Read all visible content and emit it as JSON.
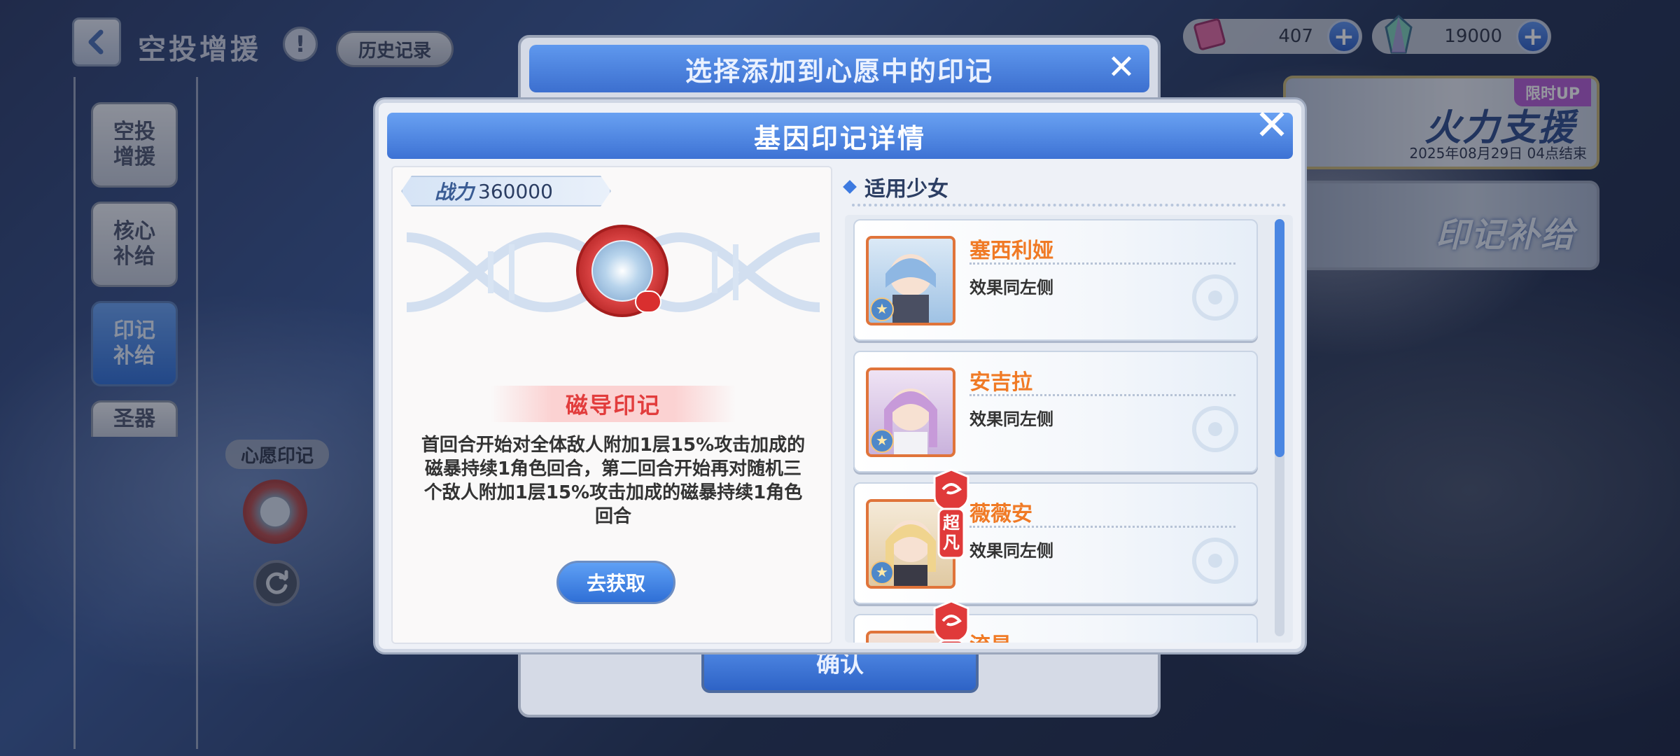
{
  "header": {
    "title": "空投增援",
    "history_label": "历史记录"
  },
  "sidebar": {
    "items": [
      {
        "label": "空投增援",
        "active": false
      },
      {
        "label": "核心补给",
        "active": false
      },
      {
        "label": "印记补给",
        "active": true
      },
      {
        "label": "圣器",
        "active": false
      }
    ],
    "wish_label": "心愿印记"
  },
  "currencies": [
    {
      "icon": "pink-ticket-icon",
      "value": "407"
    },
    {
      "icon": "crystal-icon",
      "value": "19000"
    }
  ],
  "banners": {
    "limited_tag": "限时UP",
    "firepower_title": "火力支援",
    "firepower_date": "2025年08月29日 04点结束",
    "mark_supply_title": "印记补给"
  },
  "back_panel": {
    "title": "选择添加到心愿中的印记",
    "confirm_label": "确认"
  },
  "modal": {
    "title": "基因印记详情",
    "power_label": "战力",
    "power_value": "360000",
    "mark_name": "磁导印记",
    "mark_description": "首回合开始对全体敌人附加1层15%攻击加成的磁暴持续1角色回合，第二回合开始再对随机三个敌人附加1层15%攻击加成的磁暴持续1角色回合",
    "obtain_label": "去获取",
    "applicable_title": "适用少女",
    "characters": [
      {
        "name": "塞西利娅",
        "effect": "效果同左侧",
        "super_tag": ""
      },
      {
        "name": "安吉拉",
        "effect": "效果同左侧",
        "super_tag": ""
      },
      {
        "name": "薇薇安",
        "effect": "效果同左侧",
        "super_tag": "超凡"
      },
      {
        "name": "流星",
        "effect": "",
        "super_tag": "超"
      }
    ]
  },
  "colors": {
    "accent_blue": "#3d72d4",
    "character_name": "#f07a25",
    "mark_name": "#e23d3d"
  }
}
